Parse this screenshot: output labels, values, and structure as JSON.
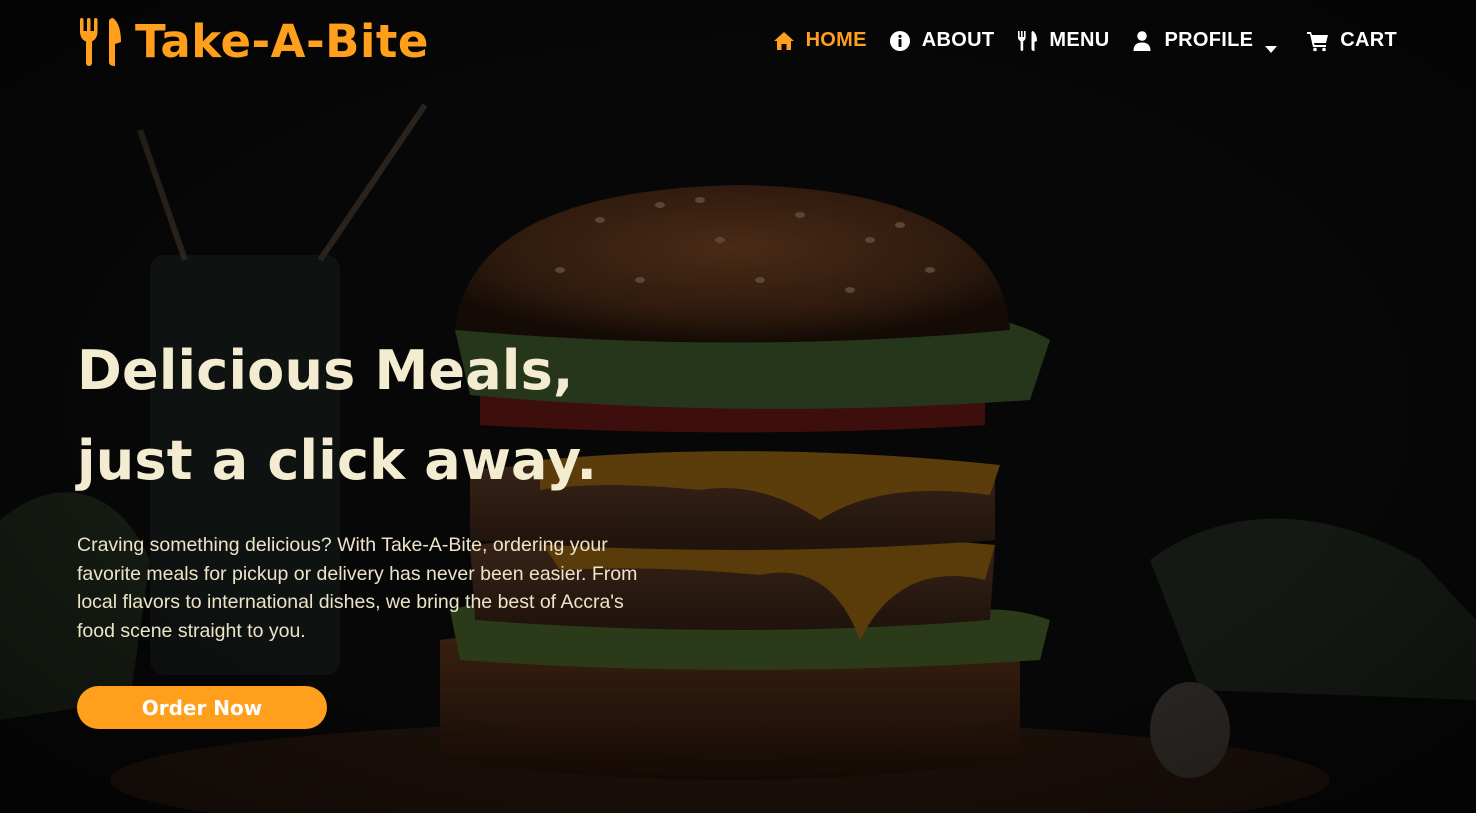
{
  "brand": {
    "name": "Take-A-Bite",
    "icon": "utensils-icon"
  },
  "nav": {
    "items": [
      {
        "label": "HOME",
        "icon": "home-icon",
        "active": true
      },
      {
        "label": "ABOUT",
        "icon": "info-circle-icon",
        "active": false
      },
      {
        "label": "MENU",
        "icon": "utensils-icon",
        "active": false
      },
      {
        "label": "PROFILE",
        "icon": "user-icon",
        "active": false,
        "dropdown": true
      },
      {
        "label": "CART",
        "icon": "cart-icon",
        "active": false
      }
    ]
  },
  "hero": {
    "title_line1": "Delicious Meals,",
    "title_line2": "just a click away.",
    "description": "Craving something delicious? With Take-A-Bite, ordering your favorite meals for pickup or delivery has never been easier. From local flavors to international dishes, we bring the best of Accra's food scene straight to you.",
    "cta_label": "Order Now",
    "background": "burger-photo"
  },
  "colors": {
    "accent": "#ff9f1c",
    "text_light": "#ffffff",
    "title_cream": "#f3ecd0",
    "desc_text": "#ede4c8",
    "button_text": "#ffffff",
    "background": "#060606"
  }
}
